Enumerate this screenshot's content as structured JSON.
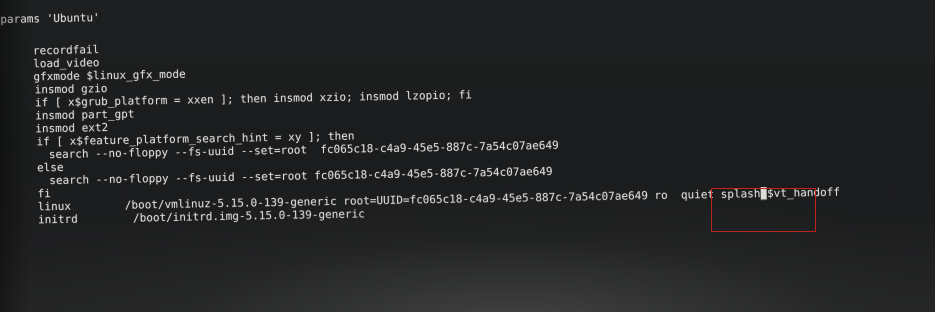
{
  "editor": {
    "title_line": "params 'Ubuntu'",
    "lines": [
      "recordfail",
      "load_video",
      "gfxmode $linux_gfx_mode",
      "insmod gzio",
      "if [ x$grub_platform = xxen ]; then insmod xzio; insmod lzopio; fi",
      "insmod part_gpt",
      "insmod ext2",
      "if [ x$feature_platform_search_hint = xy ]; then",
      "search --no-floppy --fs-uuid --set=root  fc065c18-c4a9-45e5-887c-7a54c07ae649",
      "else",
      "search --no-floppy --fs-uuid --set=root fc065c18-c4a9-45e5-887c-7a54c07ae649",
      "fi"
    ],
    "linux_line": {
      "command": "linux",
      "args": "/boot/vmlinuz-5.15.0-139-generic root=UUID=fc065c18-c4a9-45e5-887c-7a54c07ae649 ro  quiet splash",
      "cursor_char": "_",
      "args_tail": "$vt_handoff"
    },
    "initrd_line": {
      "command": "initrd",
      "args": "/boot/initrd.img-5.15.0-139-generic"
    }
  },
  "annotation": {
    "highlight_color": "#c2211c",
    "highlighted_text": "quiet splash"
  }
}
